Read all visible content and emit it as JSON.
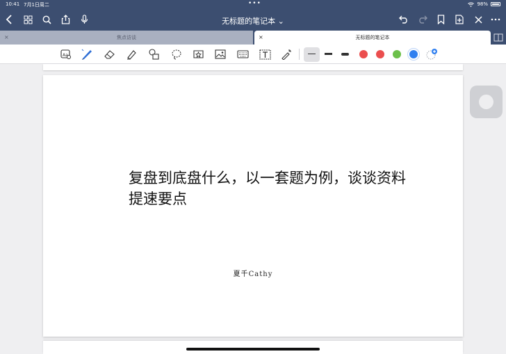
{
  "status_bar": {
    "time": "10:41",
    "date": "7月1日周二",
    "dots": "•••",
    "battery": "98%"
  },
  "navbar": {
    "title": "无标题的笔记本 ⌄"
  },
  "tabs": [
    {
      "label": "焦点访谈",
      "close": "×"
    },
    {
      "label": "无标题的笔记本",
      "close": "×"
    }
  ],
  "toolbar": {
    "tools": [
      "lasso-ocr-icon",
      "pen-icon",
      "eraser-icon",
      "highlighter-icon",
      "shapes-icon",
      "lasso-icon",
      "sticker-icon",
      "image-icon",
      "keyboard-icon",
      "textbox-icon",
      "laser-pointer-icon"
    ],
    "colors": [
      "#eb4e4e",
      "#eb4e4e",
      "#6cc04a",
      "#2f7ff0"
    ]
  },
  "page": {
    "headline": "复盘到底盘什么，以一套题为例，谈谈资料提速要点",
    "author": "夏千Cathy"
  }
}
